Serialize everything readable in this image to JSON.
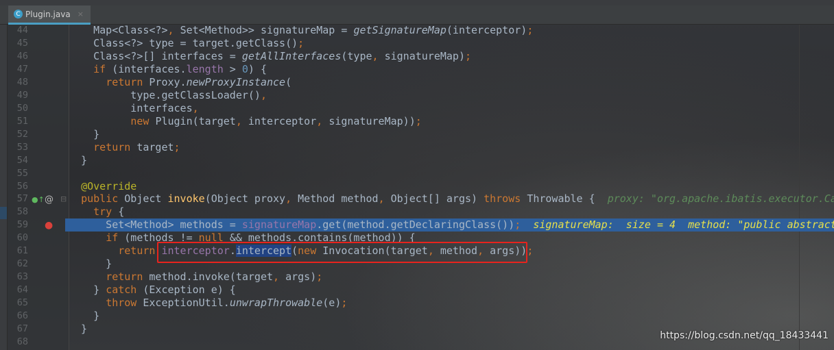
{
  "tab": {
    "file_name": "Plugin.java",
    "icon": "java-class-icon",
    "close": "×"
  },
  "colors": {
    "keyword": "#cc7832",
    "field": "#9876aa",
    "number": "#6897bb",
    "annotation": "#bbb529",
    "debug_line": "#2e5f9c",
    "highlight_box": "#e8231d"
  },
  "editor": {
    "lines": [
      {
        "num": "44",
        "tokens": [
          [
            "    Map<Class<?>",
            ""
          ],
          [
            ", ",
            "k"
          ],
          [
            "Set<Method>> signatureMap = ",
            ""
          ],
          [
            "getSignatureMap",
            "i"
          ],
          [
            "(interceptor)",
            ""
          ],
          [
            ";",
            "k"
          ]
        ]
      },
      {
        "num": "45",
        "tokens": [
          [
            "    Class<?> type = target.getClass()",
            ""
          ],
          [
            ";",
            "k"
          ]
        ]
      },
      {
        "num": "46",
        "tokens": [
          [
            "    Class<?>[] interfaces = ",
            ""
          ],
          [
            "getAllInterfaces",
            "i"
          ],
          [
            "(type",
            ""
          ],
          [
            ", ",
            "k"
          ],
          [
            "signatureMap)",
            ""
          ],
          [
            ";",
            "k"
          ]
        ]
      },
      {
        "num": "47",
        "tokens": [
          [
            "    ",
            ""
          ],
          [
            "if ",
            "k"
          ],
          [
            "(interfaces.",
            ""
          ],
          [
            "length",
            "f"
          ],
          [
            " > ",
            ""
          ],
          [
            "0",
            "n"
          ],
          [
            ") {",
            ""
          ]
        ]
      },
      {
        "num": "48",
        "tokens": [
          [
            "      ",
            ""
          ],
          [
            "return ",
            "k"
          ],
          [
            "Proxy.",
            ""
          ],
          [
            "newProxyInstance",
            "i"
          ],
          [
            "(",
            ""
          ]
        ]
      },
      {
        "num": "49",
        "tokens": [
          [
            "          type.getClassLoader()",
            ""
          ],
          [
            ",",
            "k"
          ]
        ]
      },
      {
        "num": "50",
        "tokens": [
          [
            "          interfaces",
            ""
          ],
          [
            ",",
            "k"
          ]
        ]
      },
      {
        "num": "51",
        "tokens": [
          [
            "          ",
            ""
          ],
          [
            "new ",
            "k"
          ],
          [
            "Plugin(target",
            ""
          ],
          [
            ", ",
            "k"
          ],
          [
            "interceptor",
            ""
          ],
          [
            ", ",
            "k"
          ],
          [
            "signatureMap))",
            ""
          ],
          [
            ";",
            "k"
          ]
        ]
      },
      {
        "num": "52",
        "tokens": [
          [
            "    }",
            ""
          ]
        ]
      },
      {
        "num": "53",
        "tokens": [
          [
            "    ",
            ""
          ],
          [
            "return ",
            "k"
          ],
          [
            "target",
            ""
          ],
          [
            ";",
            "k"
          ]
        ]
      },
      {
        "num": "54",
        "tokens": [
          [
            "  }",
            ""
          ]
        ]
      },
      {
        "num": "55",
        "tokens": []
      },
      {
        "num": "56",
        "tokens": [
          [
            "  ",
            ""
          ],
          [
            "@Override",
            "a"
          ]
        ]
      },
      {
        "num": "57",
        "tokens": [
          [
            "  ",
            ""
          ],
          [
            "public ",
            "k"
          ],
          [
            "Object ",
            ""
          ],
          [
            "invoke",
            "m"
          ],
          [
            "(Object proxy",
            ""
          ],
          [
            ", ",
            "k"
          ],
          [
            "Method method",
            ""
          ],
          [
            ", ",
            "k"
          ],
          [
            "Object[] args) ",
            ""
          ],
          [
            "throws ",
            "k"
          ],
          [
            "Throwable {  ",
            ""
          ],
          [
            "proxy: \"org.apache.ibatis.executor.Ca",
            "c"
          ]
        ]
      },
      {
        "num": "58",
        "tokens": [
          [
            "    ",
            ""
          ],
          [
            "try ",
            "k"
          ],
          [
            "{",
            ""
          ]
        ]
      },
      {
        "num": "59",
        "debug": true,
        "tokens": [
          [
            "      Set<Method> methods = ",
            ""
          ],
          [
            "signatureMap",
            "f"
          ],
          [
            ".get(method.getDeclaringClass())",
            ""
          ],
          [
            ";",
            "k"
          ],
          [
            "  signatureMap:  size = 4  method: \"public abstract",
            "y"
          ]
        ]
      },
      {
        "num": "60",
        "tokens": [
          [
            "      ",
            ""
          ],
          [
            "if ",
            "k"
          ],
          [
            "(methods != ",
            ""
          ],
          [
            "null ",
            "k"
          ],
          [
            "&& methods.contains(method)) {",
            ""
          ]
        ]
      },
      {
        "num": "61",
        "tokens": [
          [
            "        ",
            ""
          ],
          [
            "return ",
            "k"
          ],
          [
            "interceptor",
            "f"
          ],
          [
            ".",
            ""
          ],
          [
            "intercept",
            "sel"
          ],
          [
            "(",
            ""
          ],
          [
            "new ",
            "k"
          ],
          [
            "Invocation(target",
            ""
          ],
          [
            ", ",
            "k"
          ],
          [
            "method",
            ""
          ],
          [
            ", ",
            "k"
          ],
          [
            "args))",
            ""
          ],
          [
            ";",
            "k"
          ]
        ]
      },
      {
        "num": "62",
        "tokens": [
          [
            "      }",
            ""
          ]
        ]
      },
      {
        "num": "63",
        "tokens": [
          [
            "      ",
            ""
          ],
          [
            "return ",
            "k"
          ],
          [
            "method.invoke(target",
            ""
          ],
          [
            ", ",
            "k"
          ],
          [
            "args)",
            ""
          ],
          [
            ";",
            "k"
          ]
        ]
      },
      {
        "num": "64",
        "tokens": [
          [
            "    } ",
            ""
          ],
          [
            "catch ",
            "k"
          ],
          [
            "(Exception e) {",
            ""
          ]
        ]
      },
      {
        "num": "65",
        "tokens": [
          [
            "      ",
            ""
          ],
          [
            "throw ",
            "k"
          ],
          [
            "ExceptionUtil.",
            ""
          ],
          [
            "unwrapThrowable",
            "i"
          ],
          [
            "(e)",
            ""
          ],
          [
            ";",
            "k"
          ]
        ]
      },
      {
        "num": "66",
        "tokens": [
          [
            "    }",
            ""
          ]
        ]
      },
      {
        "num": "67",
        "tokens": [
          [
            "  }",
            ""
          ]
        ]
      },
      {
        "num": "68",
        "tokens": []
      }
    ]
  },
  "watermark": "https://blog.csdn.net/qq_18433441"
}
